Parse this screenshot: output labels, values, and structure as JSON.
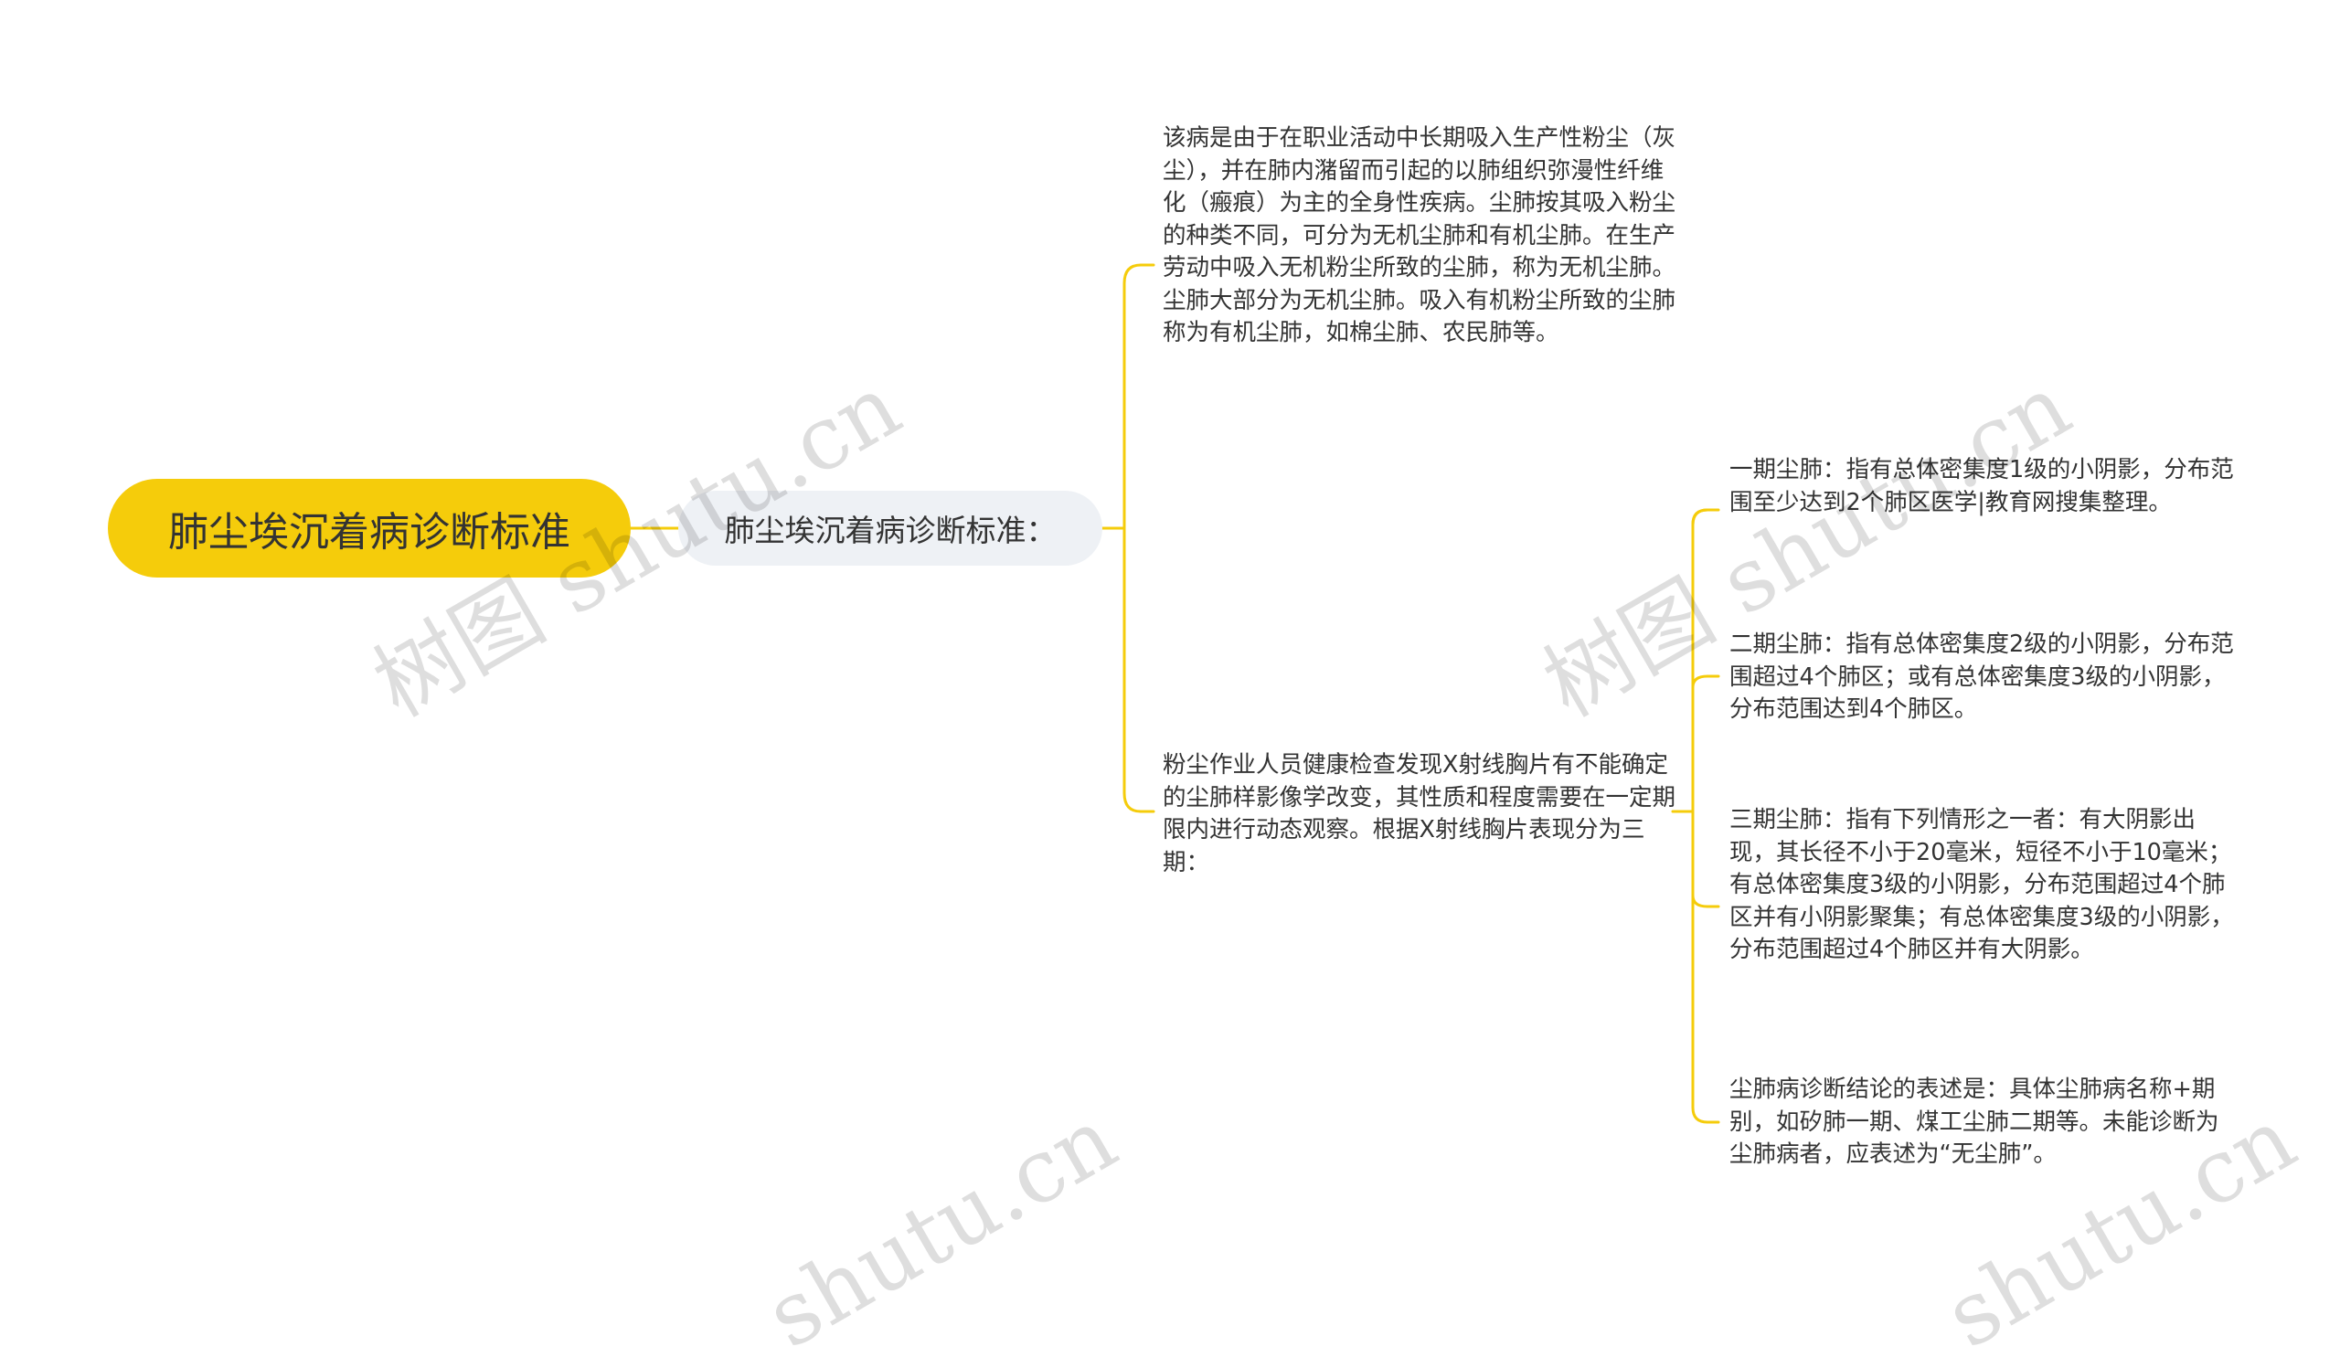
{
  "colors": {
    "root_bg": "#f5cc0b",
    "sub_bg": "#eef1f5",
    "line": "#f5cc0b",
    "text": "#333333"
  },
  "root": {
    "label": "肺尘埃沉着病诊断标准"
  },
  "sub": {
    "label": "肺尘埃沉着病诊断标准："
  },
  "leaves": {
    "definition": "该病是由于在职业活动中长期吸入生产性粉尘（灰尘），并在肺内潴留而引起的以肺组织弥漫性纤维化（瘢痕）为主的全身性疾病。尘肺按其吸入粉尘的种类不同，可分为无机尘肺和有机尘肺。在生产劳动中吸入无机粉尘所致的尘肺，称为无机尘肺。尘肺大部分为无机尘肺。吸入有机粉尘所致的尘肺称为有机尘肺，如棉尘肺、农民肺等。",
    "staging": "粉尘作业人员健康检查发现X射线胸片有不能确定的尘肺样影像学改变，其性质和程度需要在一定期限内进行动态观察。根据X射线胸片表现分为三期：",
    "stage1": "一期尘肺：指有总体密集度1级的小阴影，分布范围至少达到2个肺区医学|教育网搜集整理。",
    "stage2": "二期尘肺：指有总体密集度2级的小阴影，分布范围超过4个肺区；或有总体密集度3级的小阴影，分布范围达到4个肺区。",
    "stage3": "三期尘肺：指有下列情形之一者：有大阴影出现，其长径不小于20毫米，短径不小于10毫米；有总体密集度3级的小阴影，分布范围超过4个肺区并有小阴影聚集；有总体密集度3级的小阴影，分布范围超过4个肺区并有大阴影。",
    "conclusion": "尘肺病诊断结论的表述是：具体尘肺病名称+期别，如矽肺一期、煤工尘肺二期等。未能诊断为尘肺病者，应表述为“无尘肺”。"
  },
  "watermarks": [
    "树图 shutu.cn",
    "树图 shutu.cn",
    "shutu.cn",
    "shutu.cn"
  ]
}
